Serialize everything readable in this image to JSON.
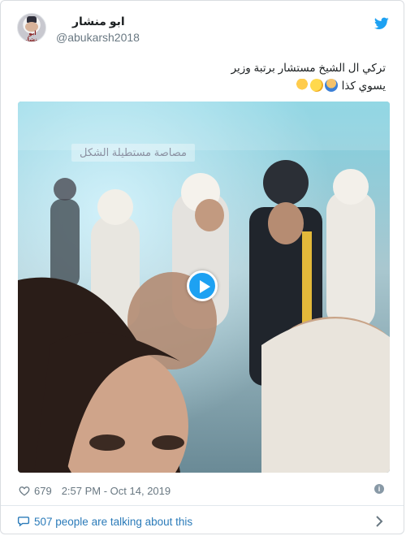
{
  "author": {
    "display_name": "ابو منشار",
    "handle": "@abukarsh2018",
    "avatar_text": "ابو منشار"
  },
  "tweet": {
    "text_line1": "تركي ال الشيخ مستشار برتبة وزير",
    "text_line2": "يسوي كذا"
  },
  "media": {
    "watermark": "مصاصة مستطيلة الشكل"
  },
  "footer": {
    "likes": "679",
    "timestamp": "2:57 PM - Oct 14, 2019",
    "talking": "507 people are talking about this"
  },
  "colors": {
    "accent": "#1da1f2",
    "link": "#2b7bb9",
    "muted": "#697882"
  },
  "icons": [
    "twitter-bird-icon",
    "play-icon",
    "heart-icon",
    "info-icon",
    "comment-bubble-icon",
    "chevron-right-icon"
  ]
}
